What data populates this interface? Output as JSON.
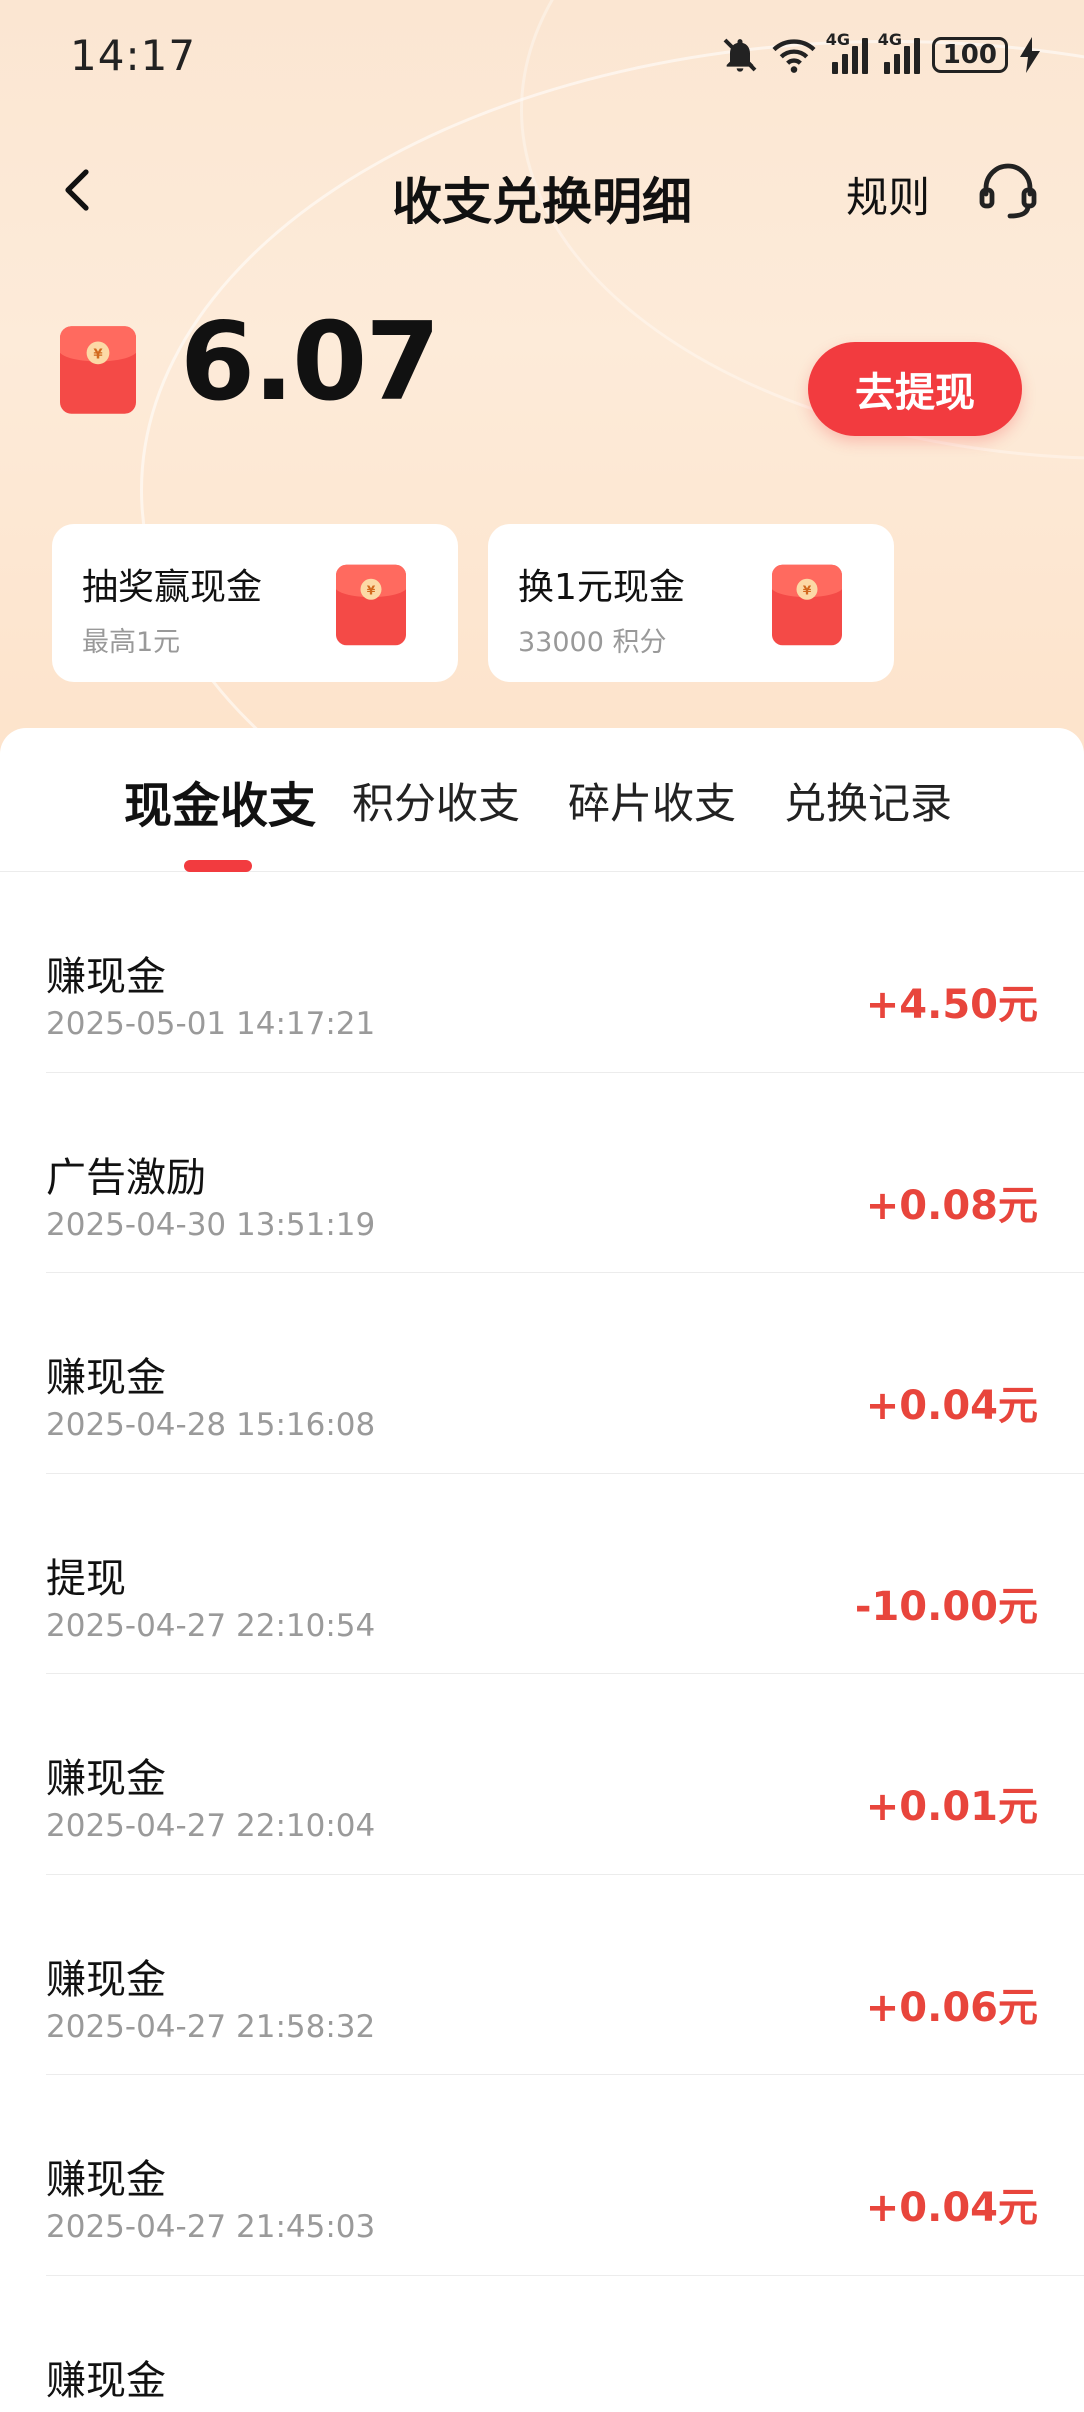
{
  "status_bar": {
    "time": "14:17",
    "network_1": "4G",
    "network_2": "4G",
    "battery": "100"
  },
  "nav": {
    "title": "收支兑换明细",
    "rules_label": "规则"
  },
  "balance": {
    "amount": "6.07",
    "withdraw_label": "去提现"
  },
  "cards": [
    {
      "title": "抽奖赢现金",
      "subtitle": "最高1元"
    },
    {
      "title": "换1元现金",
      "subtitle": "33000 积分"
    }
  ],
  "tabs": [
    {
      "label": "现金收支",
      "active": true
    },
    {
      "label": "积分收支",
      "active": false
    },
    {
      "label": "碎片收支",
      "active": false
    },
    {
      "label": "兑换记录",
      "active": false
    }
  ],
  "transactions": [
    {
      "name": "赚现金",
      "date": "2025-05-01 14:17:21",
      "amount": "+4.50元"
    },
    {
      "name": "广告激励",
      "date": "2025-04-30 13:51:19",
      "amount": "+0.08元"
    },
    {
      "name": "赚现金",
      "date": "2025-04-28 15:16:08",
      "amount": "+0.04元"
    },
    {
      "name": "提现",
      "date": "2025-04-27 22:10:54",
      "amount": "-10.00元"
    },
    {
      "name": "赚现金",
      "date": "2025-04-27 22:10:04",
      "amount": "+0.01元"
    },
    {
      "name": "赚现金",
      "date": "2025-04-27 21:58:32",
      "amount": "+0.06元"
    },
    {
      "name": "赚现金",
      "date": "2025-04-27 21:45:03",
      "amount": "+0.04元"
    },
    {
      "name": "赚现金",
      "date": "",
      "amount": ""
    }
  ],
  "colors": {
    "accent": "#f23b3f",
    "amount": "#e8453c",
    "hero_bg": "#fde8d4"
  },
  "icons": {
    "back": "chevron-left-icon",
    "service": "headset-icon",
    "red_packet": "red-envelope-icon",
    "mute": "bell-off-icon",
    "wifi": "wifi-icon",
    "charging": "bolt-icon"
  }
}
